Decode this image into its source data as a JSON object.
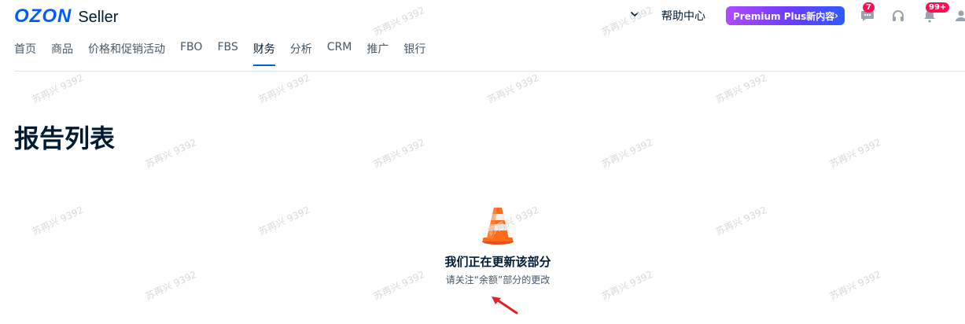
{
  "brand": {
    "logo_word": "OZON",
    "product": "Seller"
  },
  "header": {
    "help_label": "帮助中心",
    "premium_label": "Premium Plus新内容",
    "premium_arrow": "›",
    "chat_badge": "7",
    "notifications_badge": "99+"
  },
  "nav": {
    "tabs": [
      "首页",
      "商品",
      "价格和促销活动",
      "FBO",
      "FBS",
      "财务",
      "分析",
      "CRM",
      "推广",
      "银行"
    ],
    "active_index": 5
  },
  "page": {
    "title": "报告列表"
  },
  "empty_state": {
    "title": "我们正在更新该部分",
    "subtitle": "请关注“余额”部分的更改"
  },
  "watermark": "苏再兴 9392",
  "colors": {
    "accent": "#005bff",
    "badge": "#f91155",
    "cone": "#ff6b1a",
    "annotation_arrow": "#e0202a"
  }
}
